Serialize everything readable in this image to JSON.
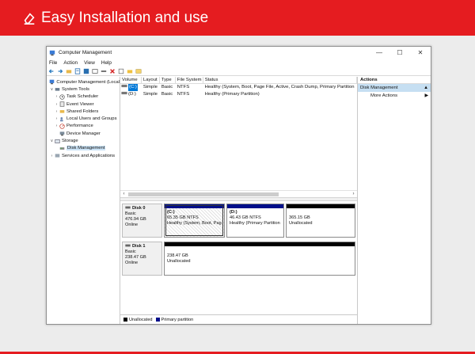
{
  "banner": {
    "title": "Easy Installation and use",
    "color": "#e51c20"
  },
  "window": {
    "title": "Computer Management",
    "controls": {
      "minimize": "—",
      "maximize": "☐",
      "close": "✕"
    },
    "menu": [
      "File",
      "Action",
      "View",
      "Help"
    ],
    "toolbar_icons": [
      "back-icon",
      "forward-icon",
      "up-folder-icon",
      "properties-icon",
      "help-icon",
      "view-icon",
      "connect-icon",
      "delete-icon",
      "checkbox-icon",
      "folder-open-icon",
      "search-icon"
    ]
  },
  "tree": {
    "root": "Computer Management (Local",
    "system_tools": "System Tools",
    "task_scheduler": "Task Scheduler",
    "event_viewer": "Event Viewer",
    "shared_folders": "Shared Folders",
    "local_users": "Local Users and Groups",
    "performance": "Performance",
    "device_manager": "Device Manager",
    "storage": "Storage",
    "disk_management": "Disk Management",
    "services": "Services and Applications"
  },
  "volumes": {
    "headers": [
      "Volume",
      "Layout",
      "Type",
      "File System",
      "Status"
    ],
    "rows": [
      {
        "volume": "(C:)",
        "layout": "Simple",
        "type": "Basic",
        "fs": "NTFS",
        "status": "Healthy (System, Boot, Page File, Active, Crash Dump, Primary Partition"
      },
      {
        "volume": "(D:)",
        "layout": "Simple",
        "type": "Basic",
        "fs": "NTFS",
        "status": "Healthy (Primary Partition)"
      }
    ]
  },
  "disks": {
    "disk0": {
      "name": "Disk 0",
      "type": "Basic",
      "size": "476.94 GB",
      "state": "Online",
      "c": {
        "name": "(C:)",
        "size": "65.35 GB NTFS",
        "status": "Healthy (System, Boot, Pag"
      },
      "d": {
        "name": "(D:)",
        "size": "46.43 GB NTFS",
        "status": "Healthy (Primary Partition"
      },
      "u": {
        "size": "365.15 GB",
        "status": "Unallocated"
      }
    },
    "disk1": {
      "name": "Disk 1",
      "type": "Basic",
      "size": "238.47 GB",
      "state": "Online",
      "u": {
        "size": "238.47 GB",
        "status": "Unallocated"
      }
    }
  },
  "legend": {
    "unallocated": "Unallocated",
    "primary": "Primary partition",
    "unallocated_color": "#000000",
    "primary_color": "#000f8a"
  },
  "actions": {
    "header": "Actions",
    "section": "Disk Management",
    "more": "More Actions"
  }
}
